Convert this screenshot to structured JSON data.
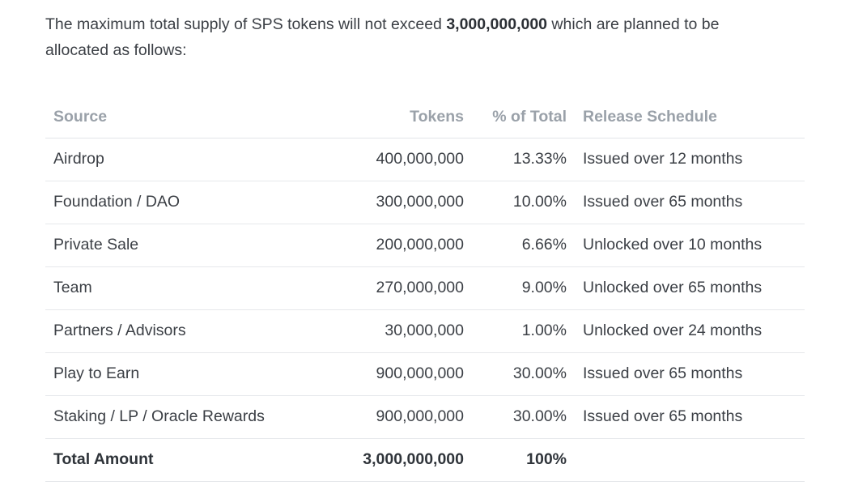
{
  "intro": {
    "before": "The maximum total supply of SPS tokens will not exceed ",
    "amount": "3,000,000,000",
    "after": " which are planned to be allocated as follows:"
  },
  "table": {
    "headers": {
      "source": "Source",
      "tokens": "Tokens",
      "pct": "% of Total",
      "schedule": "Release Schedule"
    },
    "rows": [
      {
        "source": "Airdrop",
        "tokens": "400,000,000",
        "pct": "13.33%",
        "schedule": "Issued over 12 months"
      },
      {
        "source": "Foundation / DAO",
        "tokens": "300,000,000",
        "pct": "10.00%",
        "schedule": "Issued over 65 months"
      },
      {
        "source": "Private Sale",
        "tokens": "200,000,000",
        "pct": "6.66%",
        "schedule": "Unlocked over 10 months"
      },
      {
        "source": "Team",
        "tokens": "270,000,000",
        "pct": "9.00%",
        "schedule": "Unlocked over 65 months"
      },
      {
        "source": "Partners / Advisors",
        "tokens": "30,000,000",
        "pct": "1.00%",
        "schedule": "Unlocked over 24 months"
      },
      {
        "source": "Play to Earn",
        "tokens": "900,000,000",
        "pct": "30.00%",
        "schedule": "Issued over 65 months"
      },
      {
        "source": "Staking / LP / Oracle Rewards",
        "tokens": "900,000,000",
        "pct": "30.00%",
        "schedule": "Issued over 65 months"
      }
    ],
    "total": {
      "source": "Total Amount",
      "tokens": "3,000,000,000",
      "pct": "100%",
      "schedule": ""
    }
  }
}
